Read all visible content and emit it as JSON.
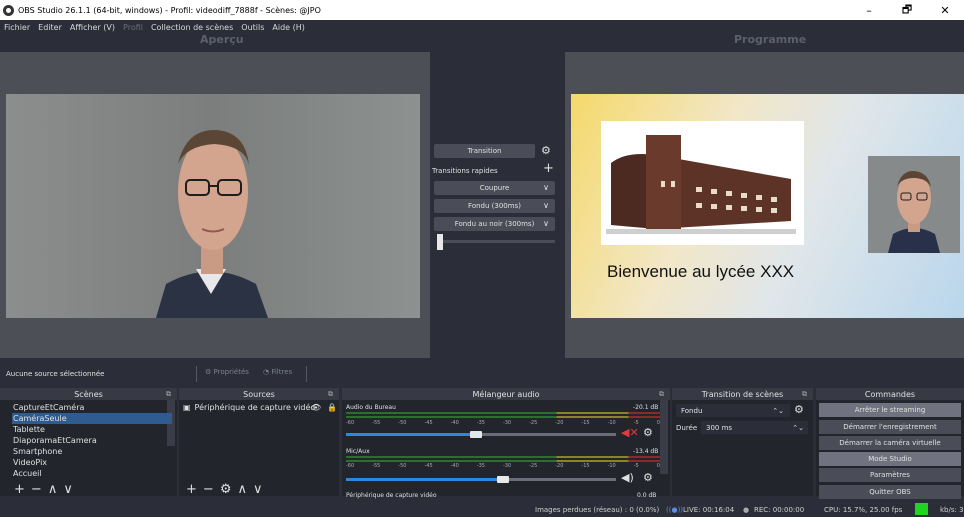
{
  "window": {
    "title": "OBS Studio 26.1.1 (64-bit, windows) - Profil: videodiff_7888f - Scènes: @JPO",
    "minimize": "–",
    "maximize": "🗗",
    "close": "✕"
  },
  "menu": {
    "items": [
      "Fichier",
      "Editer",
      "Afficher (V)",
      "Profil",
      "Collection de scènes",
      "Outils",
      "Aide (H)"
    ]
  },
  "preview": {
    "heading": "Aperçu"
  },
  "program": {
    "heading": "Programme",
    "welcome_text": "Bienvenue au lycée XXX"
  },
  "transition_panel": {
    "transition_button": "Transition",
    "quick_label": "Transitions rapides",
    "items": [
      "Coupure",
      "Fondu (300ms)",
      "Fondu au noir (300ms)"
    ]
  },
  "source_bar": {
    "no_source": "Aucune source sélectionnée",
    "properties": "Propriétés",
    "filters": "Filtres"
  },
  "docks": {
    "scenes": "Scènes",
    "sources": "Sources",
    "mixer": "Mélangeur audio",
    "scene_transitions": "Transition de scènes",
    "controls": "Commandes"
  },
  "scenes": {
    "items": [
      "CaptureEtCaméra",
      "CaméraSeule",
      "Tablette",
      "DiaporamaEtCamera",
      "Smartphone",
      "VideoPix",
      "Accueil"
    ],
    "selected_index": 1
  },
  "sources": {
    "items": [
      {
        "label": "Périphérique de capture vidéo"
      }
    ]
  },
  "mixer": {
    "channels": [
      {
        "name": "Audio du Bureau",
        "db": "-20.1 dB",
        "volume": 0.48,
        "muted": true
      },
      {
        "name": "Mic/Aux",
        "db": "-13.4 dB",
        "volume": 0.58,
        "muted": false
      },
      {
        "name": "Périphérique de capture vidéo",
        "db": "0.0 dB"
      }
    ],
    "ticks": [
      "-60",
      "-55",
      "-50",
      "-45",
      "-40",
      "-35",
      "-30",
      "-25",
      "-20",
      "-15",
      "-10",
      "-5",
      "0"
    ]
  },
  "scene_transitions": {
    "type": "Fondu",
    "duration_label": "Durée",
    "duration": "300 ms"
  },
  "controls": {
    "buttons": [
      "Arrêter le streaming",
      "Démarrer l'enregistrement",
      "Démarrer la caméra virtuelle",
      "Mode Studio",
      "Paramètres",
      "Quitter OBS"
    ]
  },
  "status": {
    "dropped": "Images perdues (réseau) : 0 (0.0%)",
    "live": "LIVE: 00:16:04",
    "rec": "REC: 00:00:00",
    "cpu": "CPU: 15.7%, 25.00 fps",
    "kbs": "kb/s: 3"
  }
}
